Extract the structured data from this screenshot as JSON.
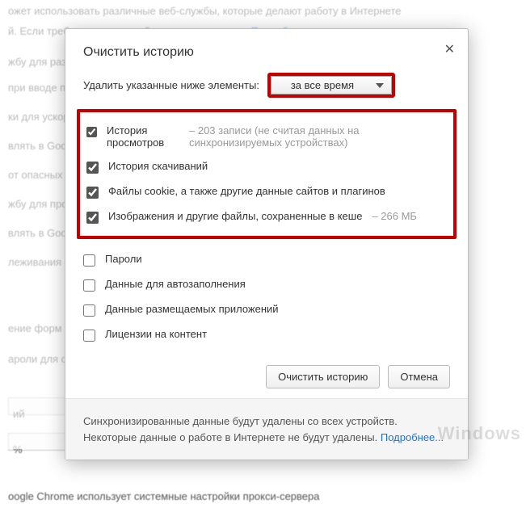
{
  "bg": {
    "p0": "ожет использовать различные веб-службы, которые делают работу в Интернете",
    "p1": "й. Если требуется, эти службы можно отключить.",
    "p1_link": "Подробнее...",
    "p2": "жбу для разр",
    "p3": "при вводе п",
    "p4": "ки для ускоря",
    "p5": "влять в Googl",
    "p6": "от опасных са",
    "p7": "жбу для пров",
    "p8": "влять в Googl",
    "p9": "леживания о",
    "p10": "ение форм од",
    "p11": "ароли для о",
    "p12": "ий",
    "p13": "%",
    "p14": "oogle Chrome использует системные настройки прокси-сервера"
  },
  "dialog": {
    "title": "Очистить историю",
    "deleteLabel": "Удалить указанные ниже элементы:",
    "timeRange": "за все время",
    "opts": [
      {
        "id": "browsing",
        "checked": true,
        "label": "История просмотров",
        "extra": "203 записи (не считая данных на синхронизируемых устройствах)"
      },
      {
        "id": "downloads",
        "checked": true,
        "label": "История скачиваний",
        "extra": ""
      },
      {
        "id": "cookies",
        "checked": true,
        "label": "Файлы cookie, а также другие данные сайтов и плагинов",
        "extra": ""
      },
      {
        "id": "cache",
        "checked": true,
        "label": "Изображения и другие файлы, сохраненные в кеше",
        "extra": "266 МБ"
      }
    ],
    "optsPlain": [
      {
        "id": "passwords",
        "checked": false,
        "label": "Пароли"
      },
      {
        "id": "autofill",
        "checked": false,
        "label": "Данные для автозаполнения"
      },
      {
        "id": "hostedapps",
        "checked": false,
        "label": "Данные размещаемых приложений"
      },
      {
        "id": "licenses",
        "checked": false,
        "label": "Лицензии на контент"
      }
    ],
    "btnClear": "Очистить историю",
    "btnCancel": "Отмена",
    "note": "Синхронизированные данные будут удалены со всех устройств. Некоторые данные о работе в Интернете не будут удалены.",
    "noteLink": "Подробнее..."
  },
  "watermark": "Windows"
}
